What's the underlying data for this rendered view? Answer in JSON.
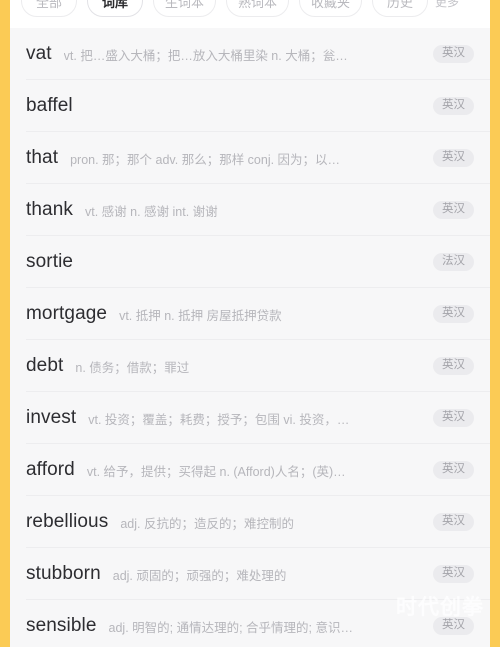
{
  "app": {
    "accent_color": "#FBCB55",
    "screen_background": "#F7F7F8",
    "badge_background": "#EBEBEE",
    "badge_text_color": "#A3A3A9"
  },
  "tab_bar": {
    "tabs": [
      {
        "label": "全部",
        "active": false
      },
      {
        "label": "词库",
        "active": true
      },
      {
        "label": "生词本",
        "active": false
      },
      {
        "label": "熟词本",
        "active": false
      },
      {
        "label": "收藏夹",
        "active": false
      },
      {
        "label": "历史",
        "active": false
      }
    ],
    "overflow_label": "更多"
  },
  "word_list": {
    "rows": [
      {
        "term": "vat",
        "definition": "vt. 把…盛入大桶；把…放入大桶里染  n. 大桶；瓮…",
        "badge": "英汉"
      },
      {
        "term": "baffel",
        "definition": "",
        "badge": "英汉"
      },
      {
        "term": "that",
        "definition": "pron. 那；那个  adv. 那么；那样  conj. 因为；以…",
        "badge": "英汉"
      },
      {
        "term": "thank",
        "definition": "vt. 感谢  n. 感谢  int. 谢谢",
        "badge": "英汉"
      },
      {
        "term": "sortie",
        "definition": "",
        "badge": "法汉"
      },
      {
        "term": "mortgage",
        "definition": "vt. 抵押  n. 抵押  房屋抵押贷款",
        "badge": "英汉"
      },
      {
        "term": "debt",
        "definition": "n. 债务；借款；罪过",
        "badge": "英汉"
      },
      {
        "term": "invest",
        "definition": "vt. 投资；覆盖；耗费；授予；包围  vi. 投资，…",
        "badge": "英汉"
      },
      {
        "term": "afford",
        "definition": "vt. 给予，提供；买得起  n. (Afford)人名；(英)…",
        "badge": "英汉"
      },
      {
        "term": "rebellious",
        "definition": "adj. 反抗的；造反的；难控制的",
        "badge": "英汉"
      },
      {
        "term": "stubborn",
        "definition": "adj. 顽固的；顽强的；难处理的",
        "badge": "英汉"
      },
      {
        "term": "sensible",
        "definition": "adj. 明智的; 通情达理的; 合乎情理的; 意识…",
        "badge": "英汉"
      }
    ]
  },
  "watermark": {
    "text": "时代创拳"
  }
}
